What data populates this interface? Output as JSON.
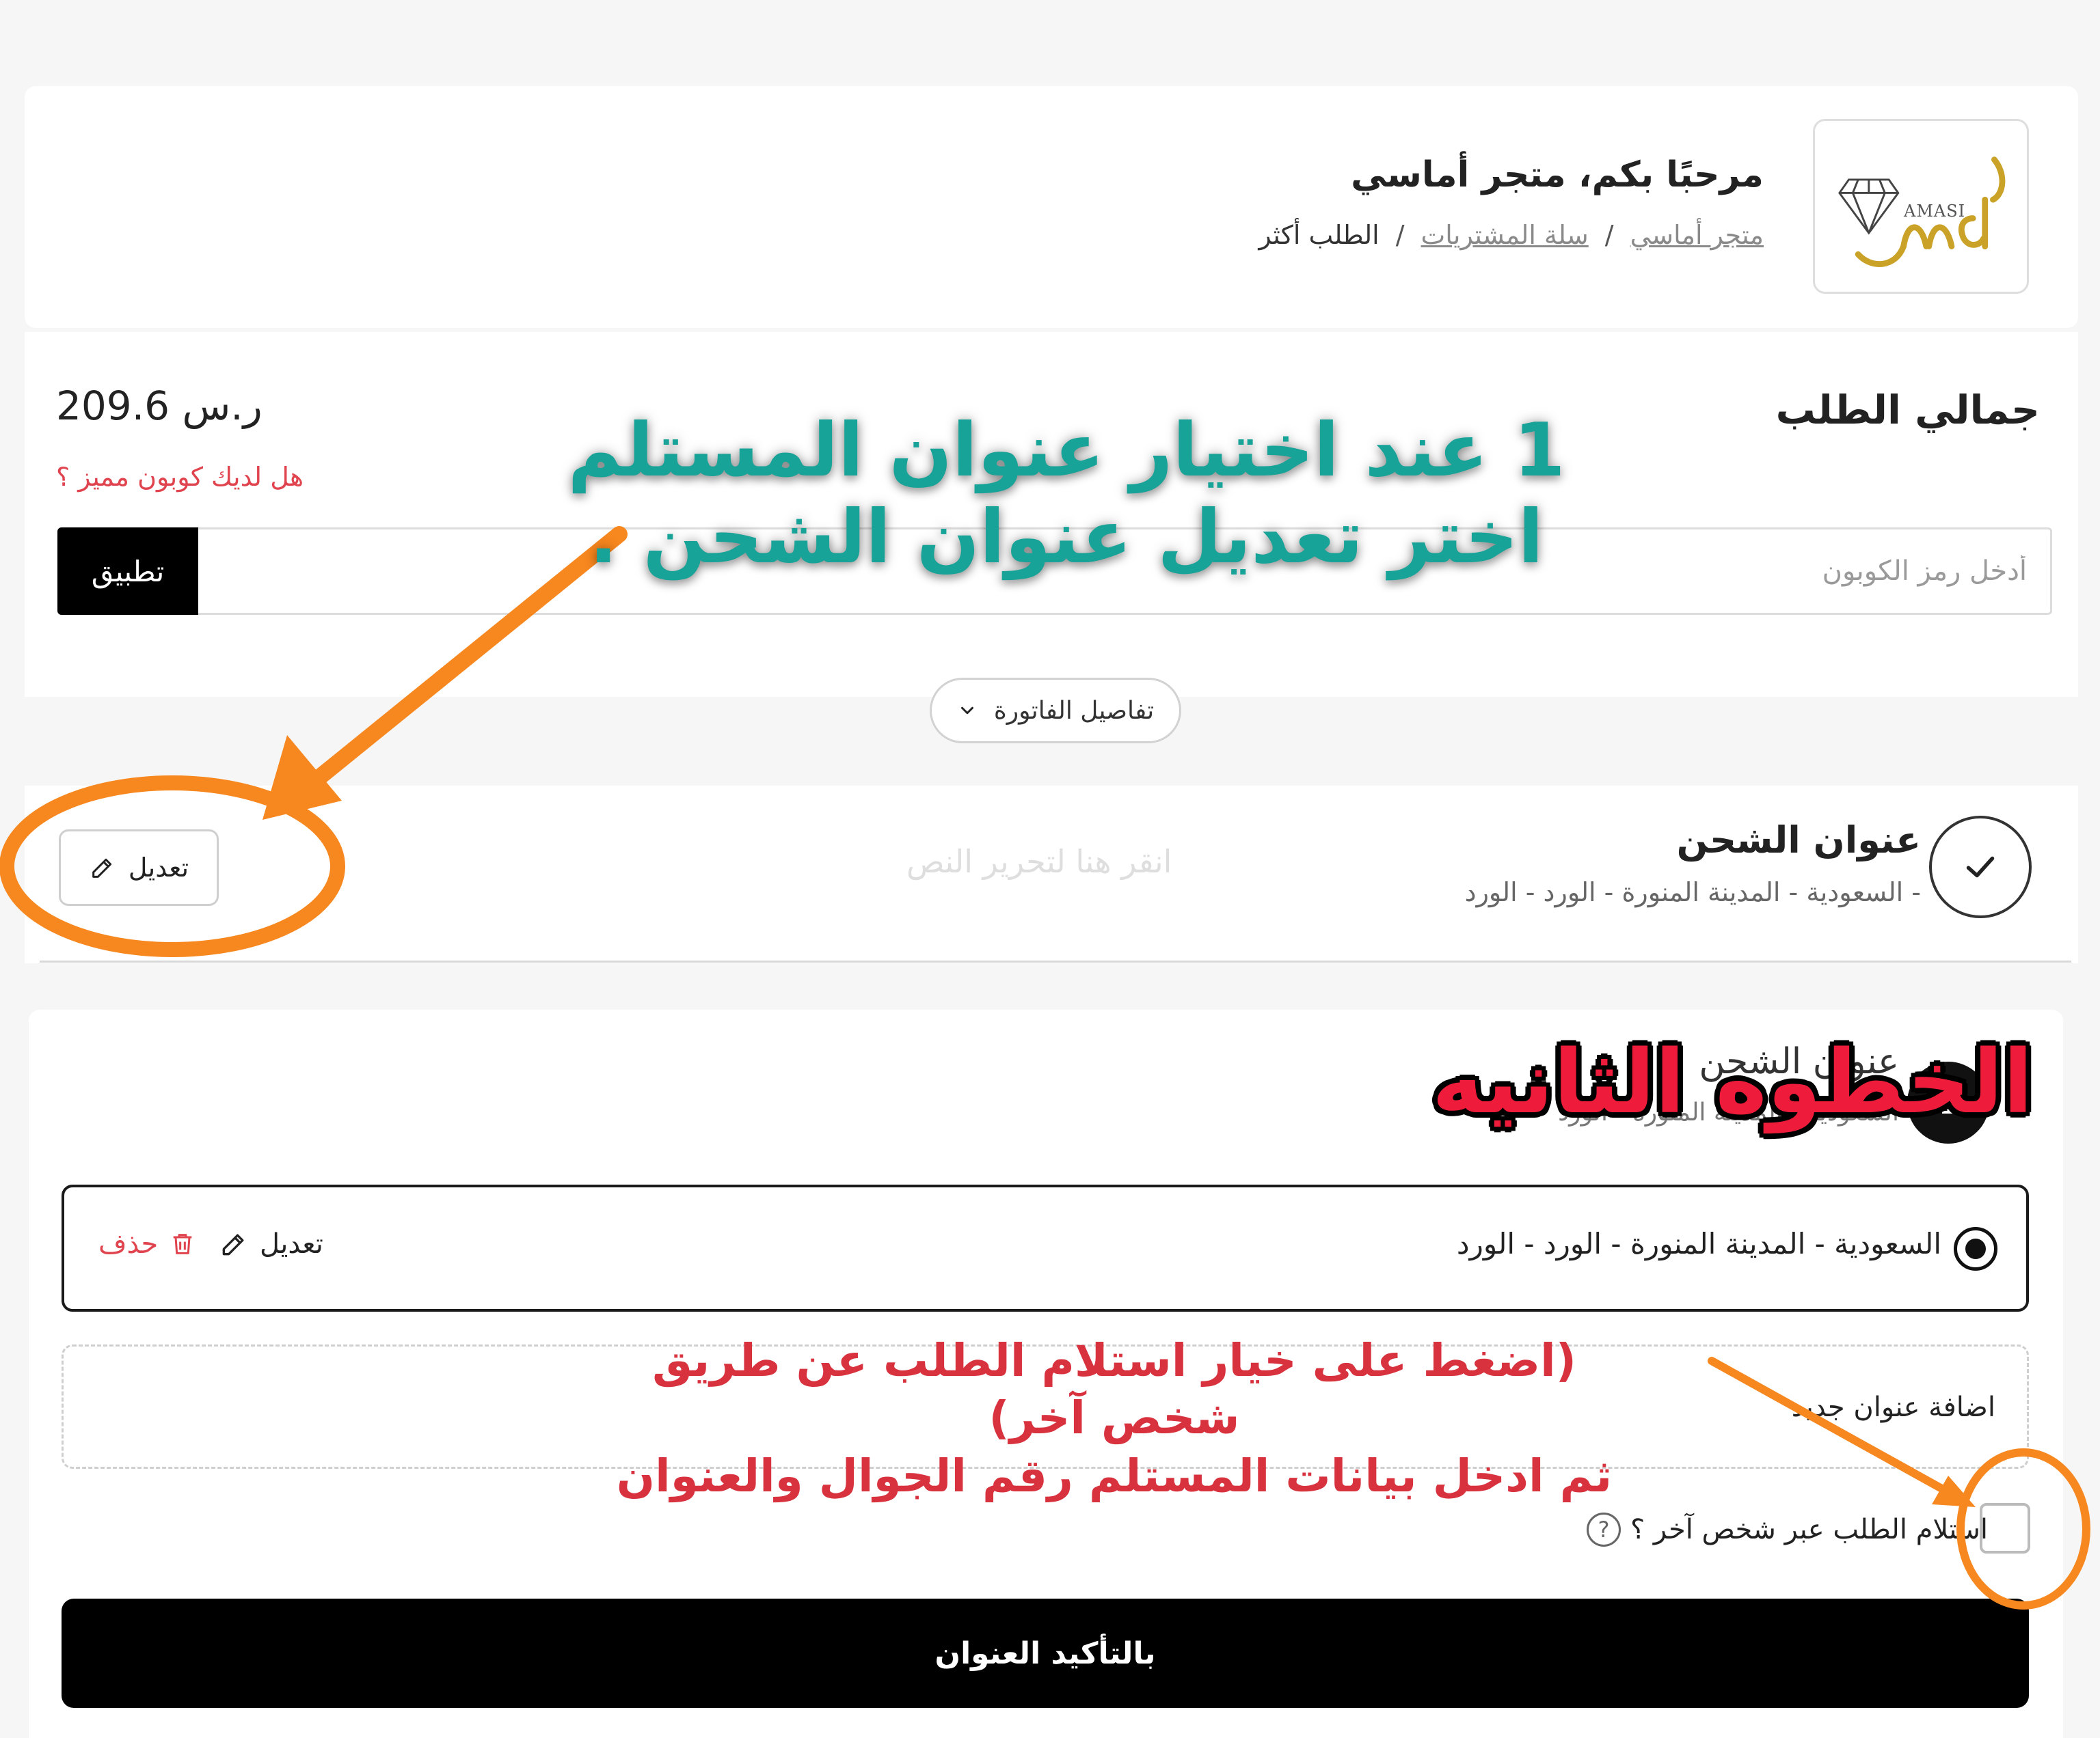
{
  "header": {
    "logo_text": "AMASI",
    "greeting": "مرحبًا بكم، متجر أماسي",
    "breadcrumb": {
      "home": "متجر أماسي",
      "cart": "سلة المشتريات",
      "current": "الطلب أكثر",
      "separator": "/"
    }
  },
  "order": {
    "total_label": "جمالي الطلب",
    "total_value": "209.6 ر.س",
    "coupon_question": "هل لديك كوبون مميز ؟",
    "coupon_placeholder": "أدخل رمز الكوبون",
    "coupon_apply": "تطبيق",
    "invoice_toggle": "تفاصيل الفاتورة"
  },
  "shipping": {
    "title": "عنوان الشحن",
    "address": "- السعودية - المدينة المنورة - الورد - الورد",
    "edit_hint": "انقر هنا لتحرير النص",
    "edit_label": "تعديل"
  },
  "address_step": {
    "number": "1",
    "title": "عنوان الشحن",
    "subtitle": "السعودية - المدينة المنورة - الورد",
    "selected_address": "السعودية - المدينة المنورة - الورد - الورد",
    "edit_label": "تعديل",
    "delete_label": "حذف",
    "add_new_label": "اضافة عنوان جديد",
    "other_person_label": "استلام الطلب عبر شخص آخر ؟",
    "help_glyph": "?",
    "confirm_label": "بالتأكيد العنوان"
  },
  "annotations": {
    "step1": "1 عند اختيار عنوان المستلم اختر تعديل عنوان الشحن .",
    "step2": "الخطوه الثانيه",
    "step2_line1": "(اضغط على خيار استلام الطلب عن طريق شخص آخر)",
    "step2_line2": "ثم ادخل بيانات المستلم رقم الجوال والعنوان",
    "colors": {
      "orange": "#f7871f",
      "teal": "#17a398",
      "red": "#ee1c3a"
    }
  },
  "colors": {
    "accent": "#000000",
    "link_red": "#e0444e",
    "logo_gold": "#c9a227"
  }
}
